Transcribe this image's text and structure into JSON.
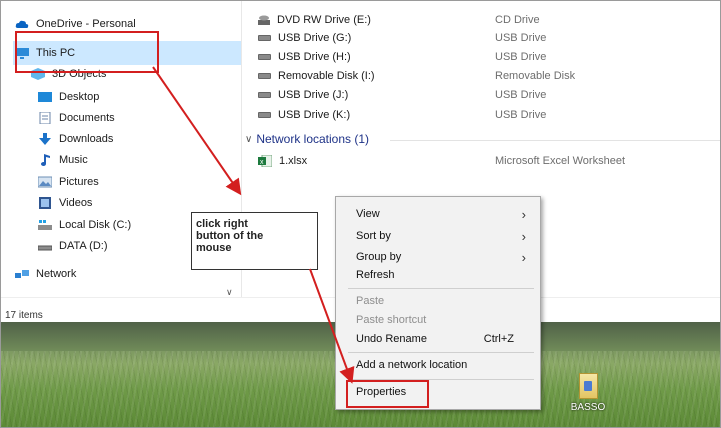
{
  "sidebar": {
    "items": [
      {
        "label": "OneDrive - Personal",
        "icon": "cloud-icon"
      },
      {
        "label": "This PC",
        "icon": "computer-icon"
      },
      {
        "label": "3D Objects",
        "icon": "3d-objects-icon"
      },
      {
        "label": "Desktop",
        "icon": "desktop-folder-icon"
      },
      {
        "label": "Documents",
        "icon": "documents-icon"
      },
      {
        "label": "Downloads",
        "icon": "downloads-icon"
      },
      {
        "label": "Music",
        "icon": "music-icon"
      },
      {
        "label": "Pictures",
        "icon": "pictures-icon"
      },
      {
        "label": "Videos",
        "icon": "videos-icon"
      },
      {
        "label": "Local Disk (C:)",
        "icon": "local-disk-icon"
      },
      {
        "label": "DATA (D:)",
        "icon": "drive-icon"
      },
      {
        "label": "Network",
        "icon": "network-icon"
      }
    ]
  },
  "status": {
    "items_count": "17 items"
  },
  "content": {
    "drives": [
      {
        "name": "DVD RW Drive (E:)",
        "type": "CD Drive"
      },
      {
        "name": "USB Drive (G:)",
        "type": "USB Drive"
      },
      {
        "name": "USB Drive (H:)",
        "type": "USB Drive"
      },
      {
        "name": "Removable Disk (I:)",
        "type": "Removable Disk"
      },
      {
        "name": "USB Drive (J:)",
        "type": "USB Drive"
      },
      {
        "name": "USB Drive (K:)",
        "type": "USB Drive"
      }
    ],
    "network_group": "Network locations (1)",
    "network_items": [
      {
        "name": "1.xlsx",
        "type": "Microsoft Excel Worksheet"
      }
    ]
  },
  "context_menu": {
    "view": "View",
    "sort_by": "Sort by",
    "group_by": "Group by",
    "refresh": "Refresh",
    "paste": "Paste",
    "paste_shortcut": "Paste shortcut",
    "undo_rename": "Undo Rename",
    "undo_shortcut": "Ctrl+Z",
    "add_network_location": "Add a network location",
    "properties": "Properties"
  },
  "annotation": {
    "note_line1": "click right",
    "note_line2": "button of the",
    "note_line3": "mouse"
  },
  "desktop": {
    "icon_label": "BASSO"
  },
  "colors": {
    "annotation_red": "#d31f1f",
    "selection_blue": "#cce8ff",
    "group_header": "#1e3287"
  }
}
